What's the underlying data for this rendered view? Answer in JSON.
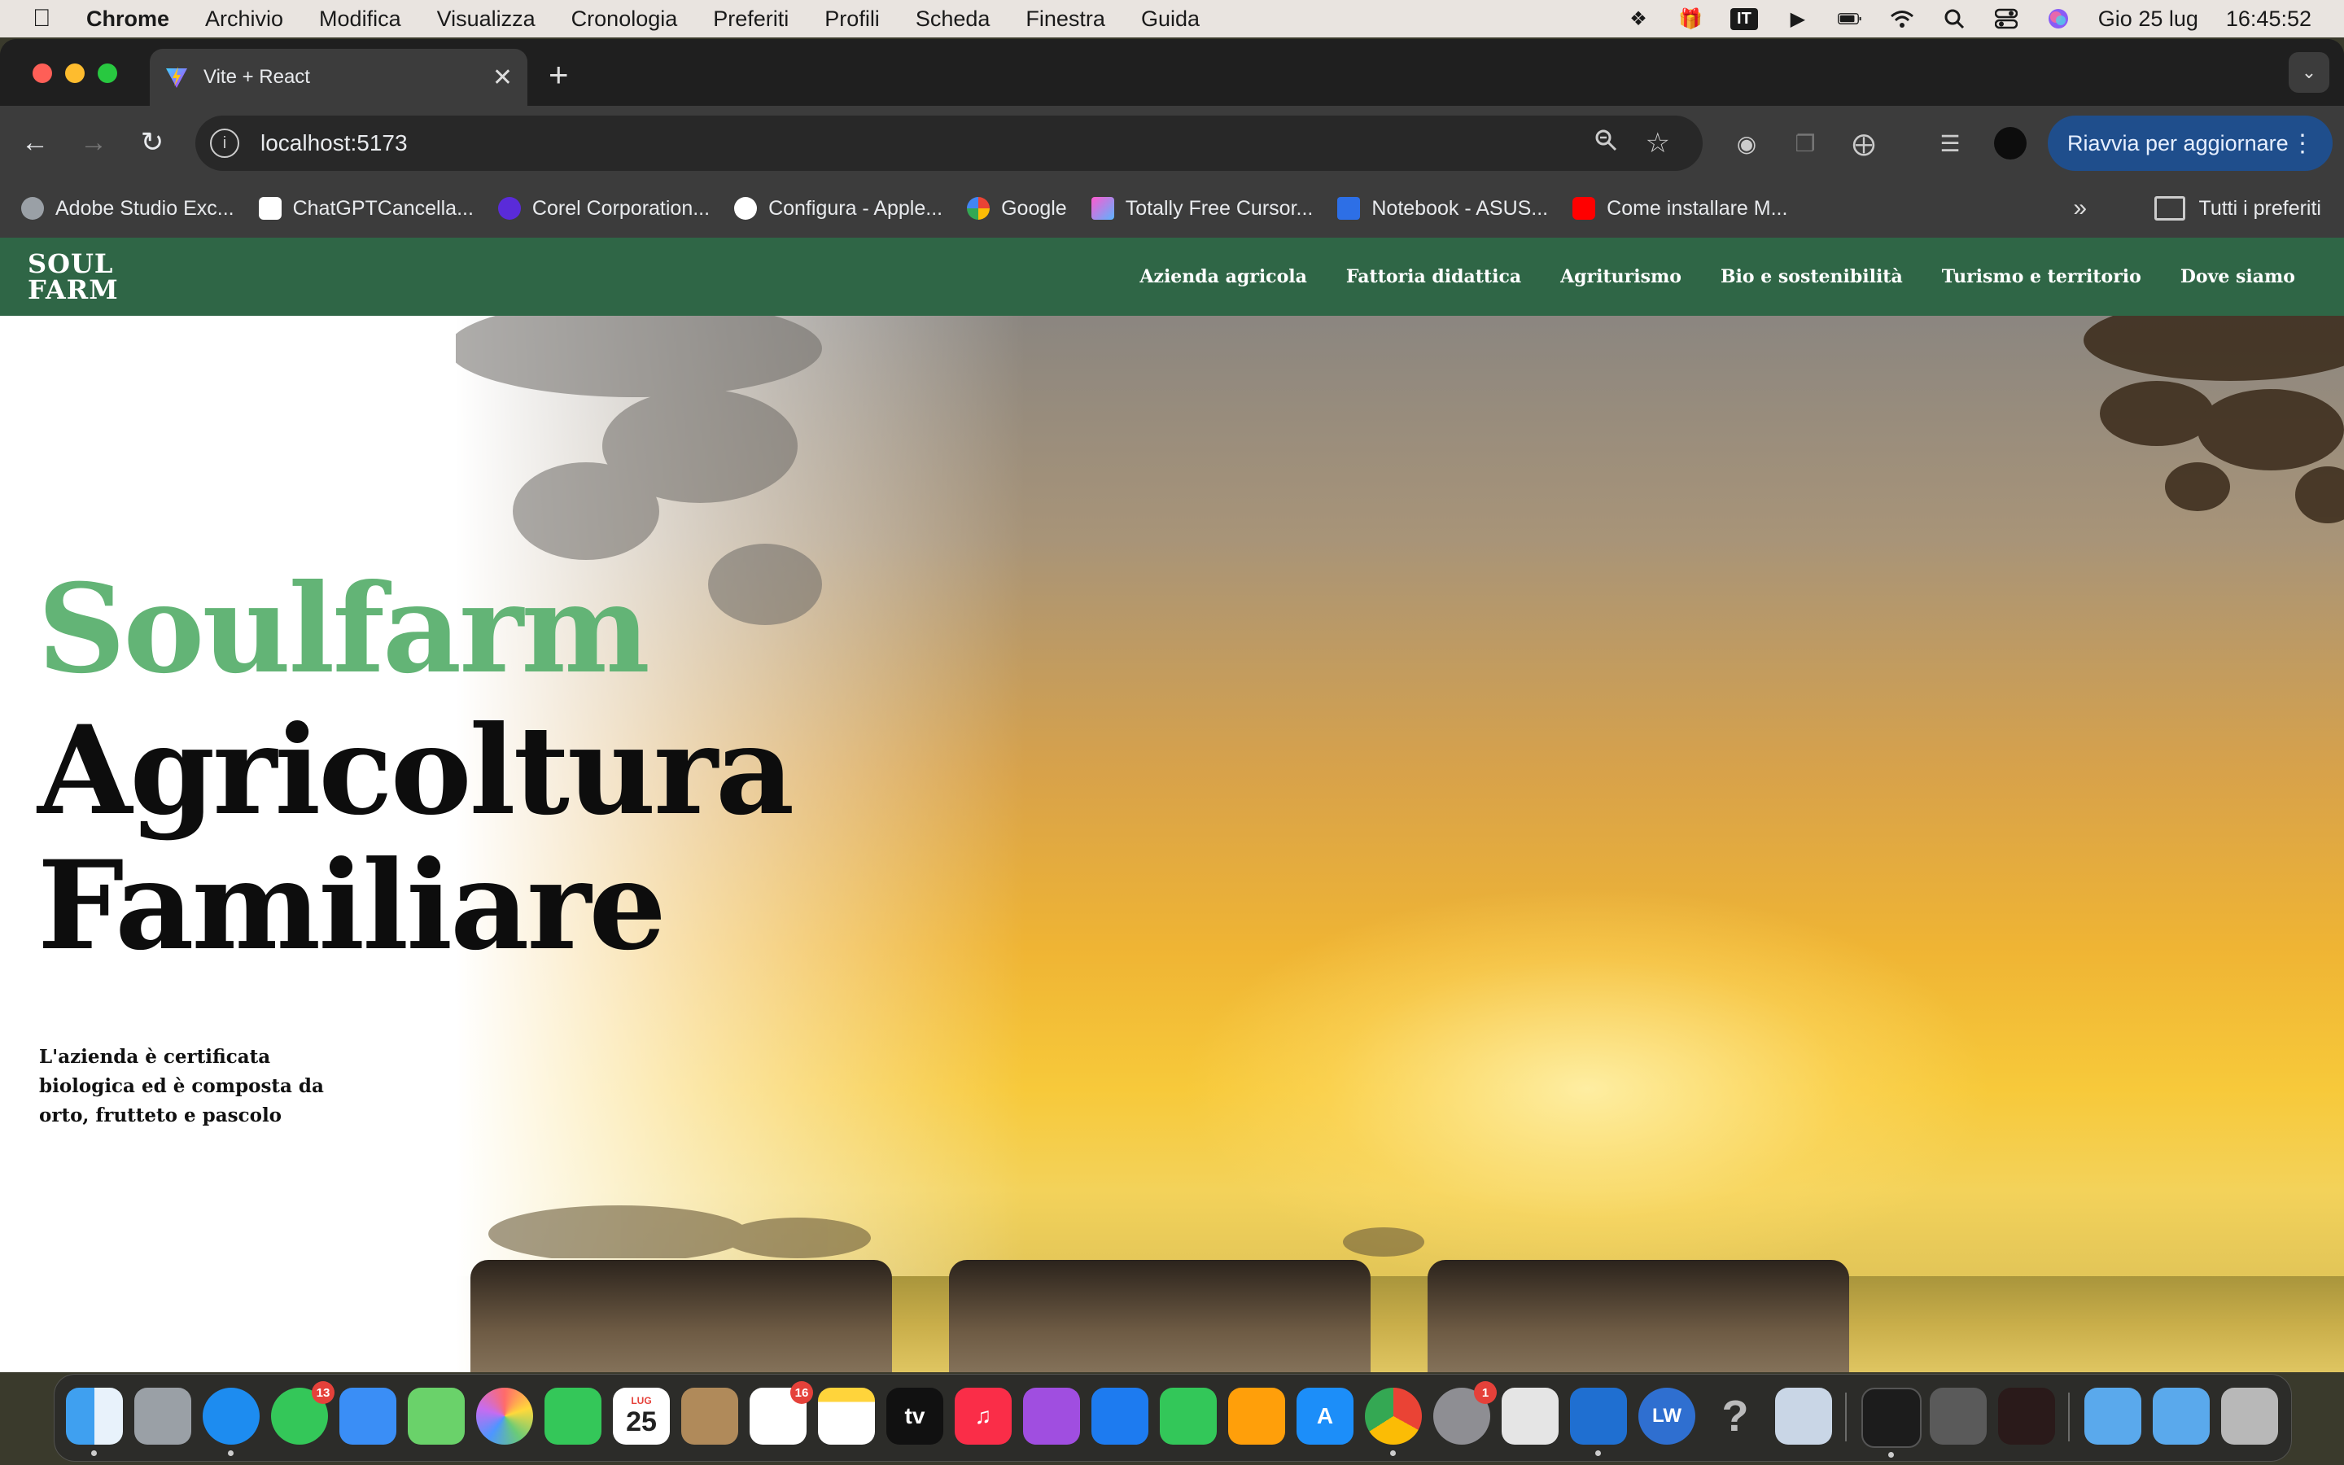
{
  "menubar": {
    "app": "Chrome",
    "items": [
      "Archivio",
      "Modifica",
      "Visualizza",
      "Cronologia",
      "Preferiti",
      "Profili",
      "Scheda",
      "Finestra",
      "Guida"
    ],
    "input_source": "IT",
    "date": "Gio 25 lug",
    "time": "16:45:52"
  },
  "browser": {
    "tab_title": "Vite + React",
    "url": "localhost:5173",
    "update_label": "Riavvia per aggiornare",
    "bookmarks": [
      "Adobe Studio Exc...",
      "ChatGPTCancella...",
      "Corel Corporation...",
      "Configura - Apple...",
      "Google",
      "Totally Free Cursor...",
      "Notebook - ASUS...",
      "Come installare M..."
    ],
    "all_bookmarks": "Tutti i preferiti"
  },
  "site": {
    "logo_line1": "SOUL",
    "logo_line2": "FARM",
    "nav": [
      "Azienda agricola",
      "Fattoria didattica",
      "Agriturismo",
      "Bio e sostenibilità",
      "Turismo e territorio",
      "Dove siamo"
    ],
    "hero_title_accent": "Soulfarm",
    "hero_title_line2": "Agricoltura",
    "hero_title_line3": "Familiare",
    "hero_subtitle": "L'azienda è certificata biologica ed è composta da orto, frutteto e pascolo",
    "accent_color": "#63b476",
    "nav_color": "#2f6646"
  },
  "dock": {
    "calendar_month": "LUG",
    "calendar_day": "25",
    "badges": {
      "messages": "13",
      "reminders": "16",
      "settings": "1"
    },
    "lw_label": "LW"
  }
}
